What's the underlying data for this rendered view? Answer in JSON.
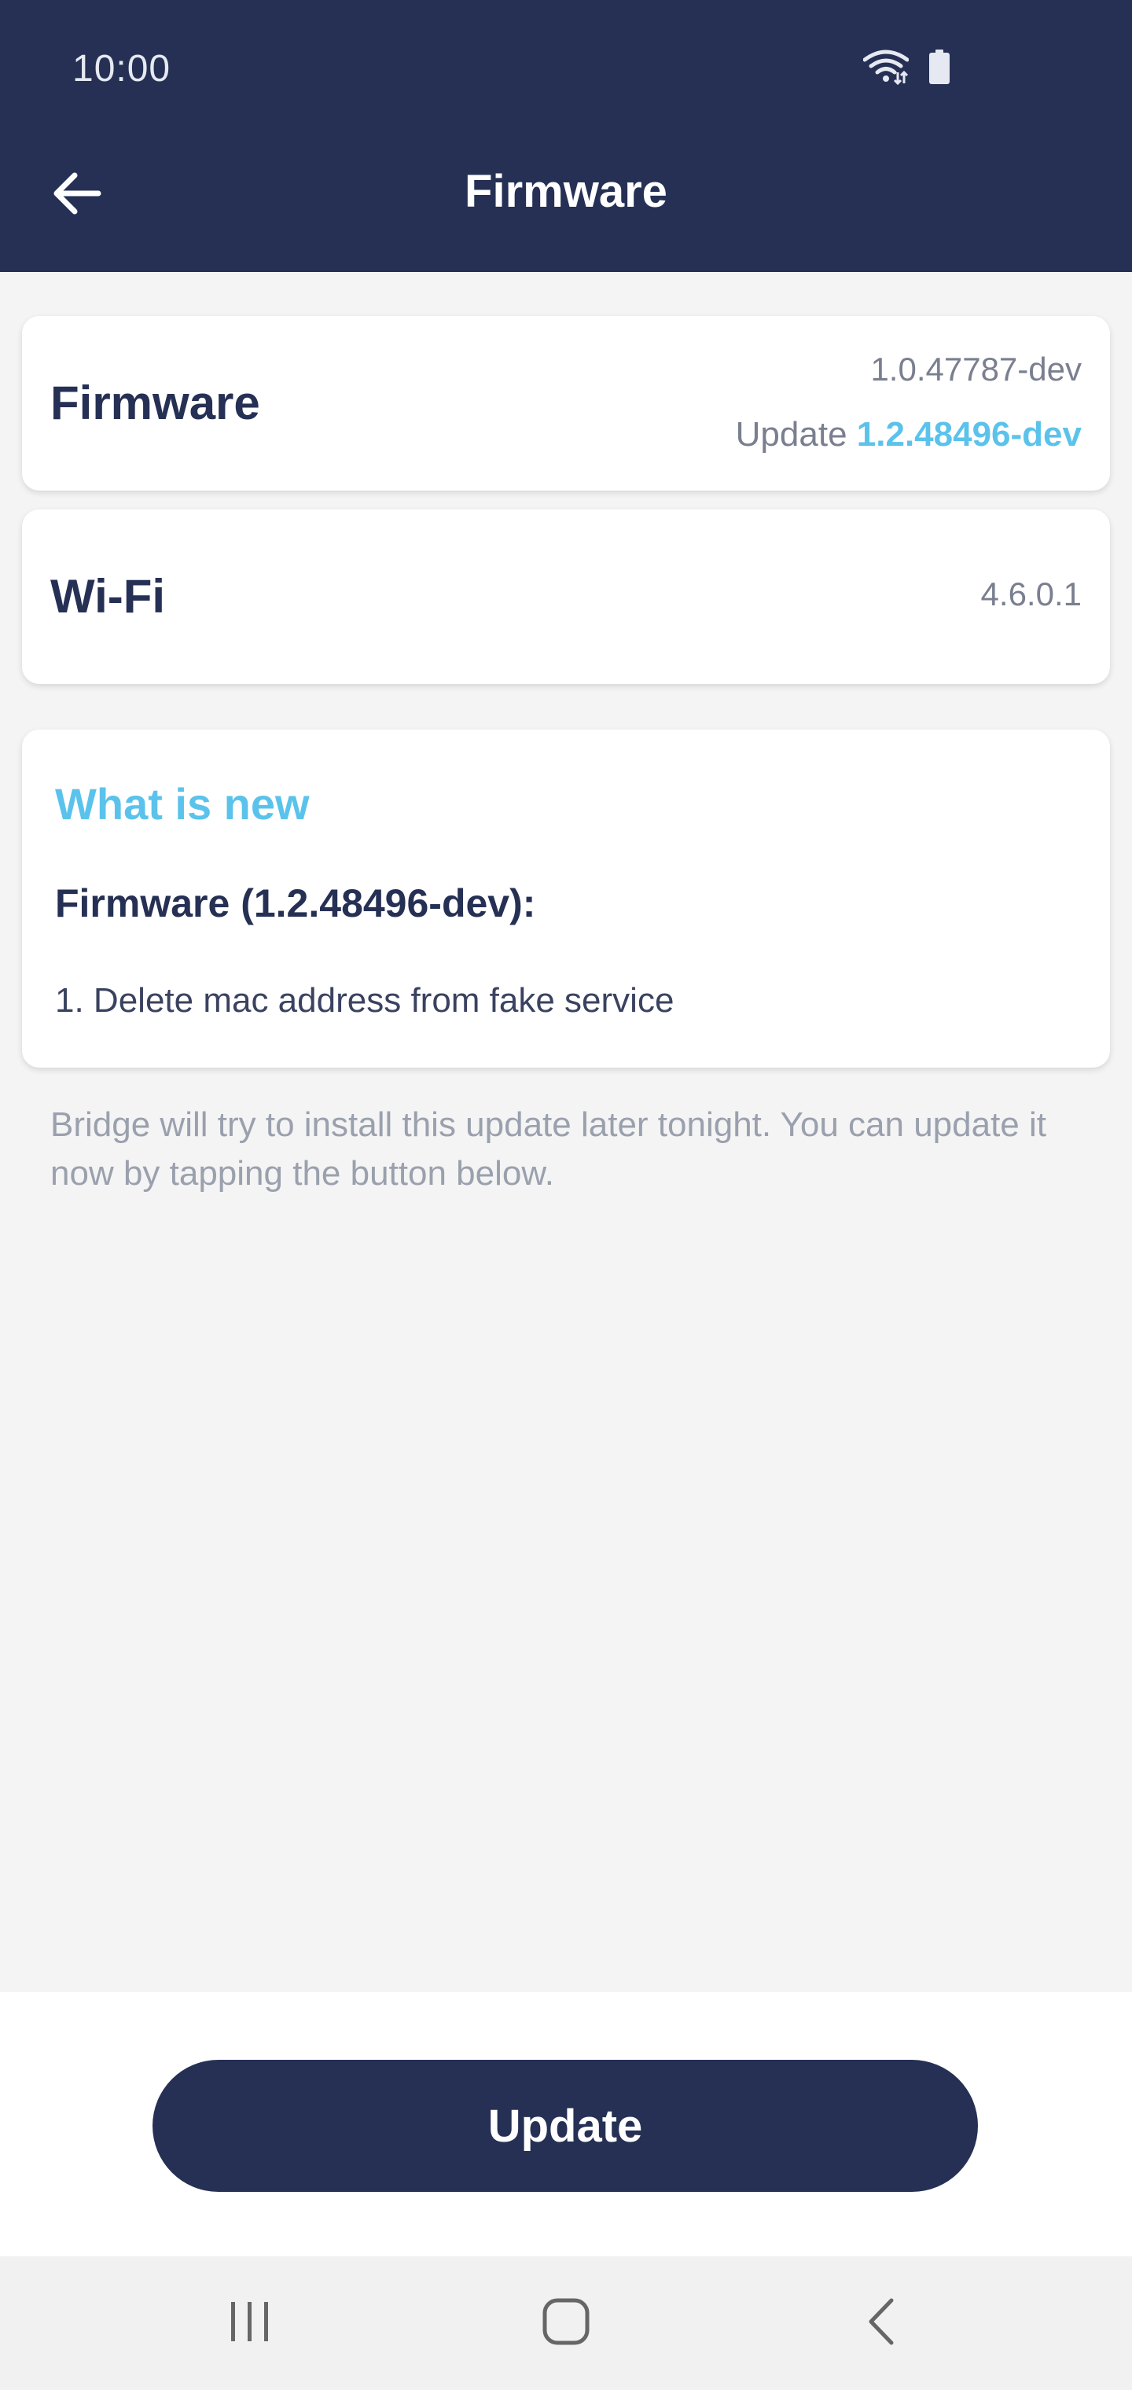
{
  "status_bar": {
    "time": "10:00",
    "icons": [
      "wifi-icon",
      "battery-icon"
    ]
  },
  "header": {
    "title": "Firmware",
    "back_icon": "arrow-left-icon"
  },
  "firmware_card": {
    "label": "Firmware",
    "current_version": "1.0.47787-dev",
    "update_prefix": "Update",
    "update_version": "1.2.48496-dev"
  },
  "wifi_card": {
    "label": "Wi-Fi",
    "version": "4.6.0.1"
  },
  "whats_new": {
    "title": "What is new",
    "subtitle": "Firmware (1.2.48496-dev):",
    "items": [
      "1. Delete mac address from fake service"
    ]
  },
  "info_text": "Bridge will try to install this update later tonight. You can update it now by tapping the button below.",
  "actions": {
    "update_label": "Update"
  },
  "nav_bar": {
    "items": [
      "recents-icon",
      "home-icon",
      "back-icon"
    ]
  },
  "colors": {
    "header_bg": "#253054",
    "accent": "#5bc3eb",
    "page_bg": "#f4f4f4",
    "button_bg": "#253054"
  }
}
